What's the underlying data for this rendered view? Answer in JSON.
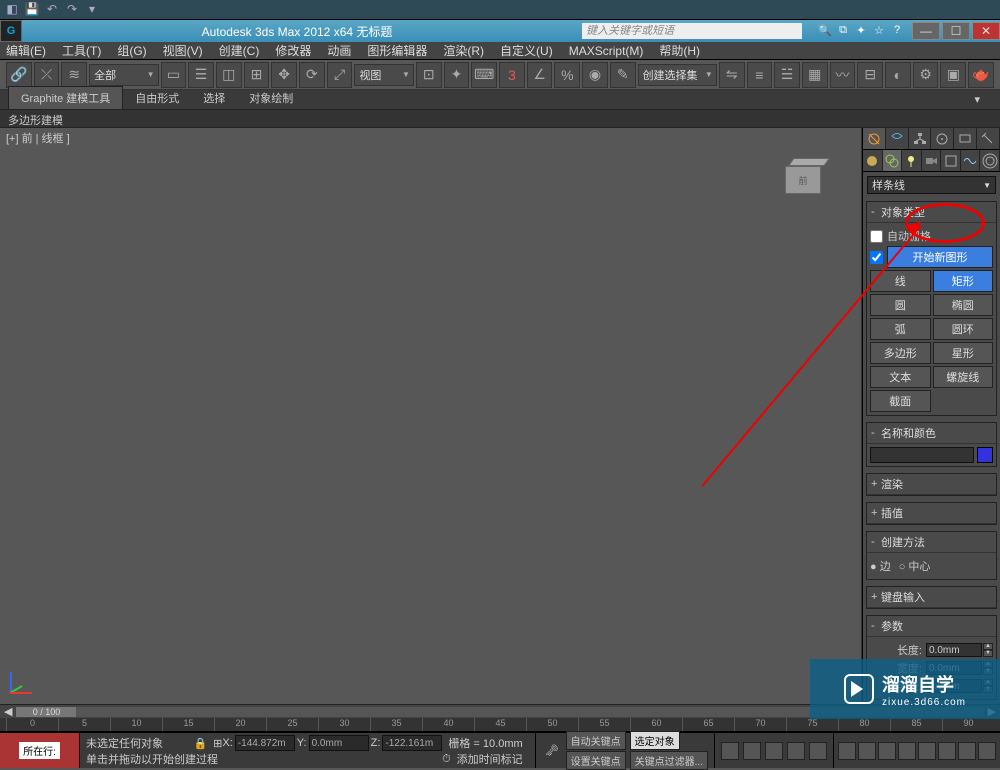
{
  "title": "Autodesk 3ds Max 2012 x64   无标题",
  "search_placeholder": "键入关键字或短语",
  "qat_icons": [
    "undo-icon",
    "redo-icon",
    "link-icon"
  ],
  "menubar": [
    "编辑(E)",
    "工具(T)",
    "组(G)",
    "视图(V)",
    "创建(C)",
    "修改器",
    "动画",
    "图形编辑器",
    "渲染(R)",
    "自定义(U)",
    "MAXScript(M)",
    "帮助(H)"
  ],
  "maintoolbar": {
    "selection_set": "全部",
    "view_label": "视图",
    "named_sel": "创建选择集"
  },
  "ribbon": {
    "tabs": [
      "Graphite 建模工具",
      "自由形式",
      "选择",
      "对象绘制"
    ],
    "subbar": "多边形建模"
  },
  "viewport_label": "[+] 前 | 线框 ]",
  "viewcube_face": "前",
  "command_panel": {
    "dropdown": "样条线",
    "object_type": {
      "header": "对象类型",
      "autogrid": "自动栅格",
      "start_new": "开始新图形",
      "buttons": [
        "线",
        "矩形",
        "圆",
        "椭圆",
        "弧",
        "圆环",
        "多边形",
        "星形",
        "文本",
        "螺旋线",
        "截面",
        ""
      ]
    },
    "name_color_header": "名称和颜色",
    "render_header": "渲染",
    "interp_header": "插值",
    "create_method": {
      "header": "创建方法",
      "opt1": "边",
      "opt2": "中心"
    },
    "keyboard_header": "键盘输入",
    "params": {
      "header": "参数",
      "length_label": "长度:",
      "width_label": "宽度:",
      "corner_label": "角半径:",
      "val": "0.0mm"
    }
  },
  "time_slider": "0 / 100",
  "ruler_ticks": [
    "0",
    "5",
    "10",
    "15",
    "20",
    "25",
    "30",
    "35",
    "40",
    "45",
    "50",
    "55",
    "60",
    "65",
    "70",
    "75",
    "80",
    "85",
    "90"
  ],
  "status": {
    "row_label": "所在行:",
    "prompt1": "未选定任何对象",
    "prompt2": "单击并拖动以开始创建过程",
    "add_time": "添加时间标记",
    "x": "-144.872m",
    "xl": "X:",
    "y": "0.0mm",
    "yl": "Y:",
    "z": "-122.161m",
    "zl": "Z:",
    "grid": "栅格 = 10.0mm",
    "autokey": "自动关键点",
    "setkey": "设置关键点",
    "selkey": "选定对象",
    "keyfilter": "关键点过滤器..."
  },
  "watermark": {
    "big": "溜溜自学",
    "small": "zixue.3d66.com"
  }
}
